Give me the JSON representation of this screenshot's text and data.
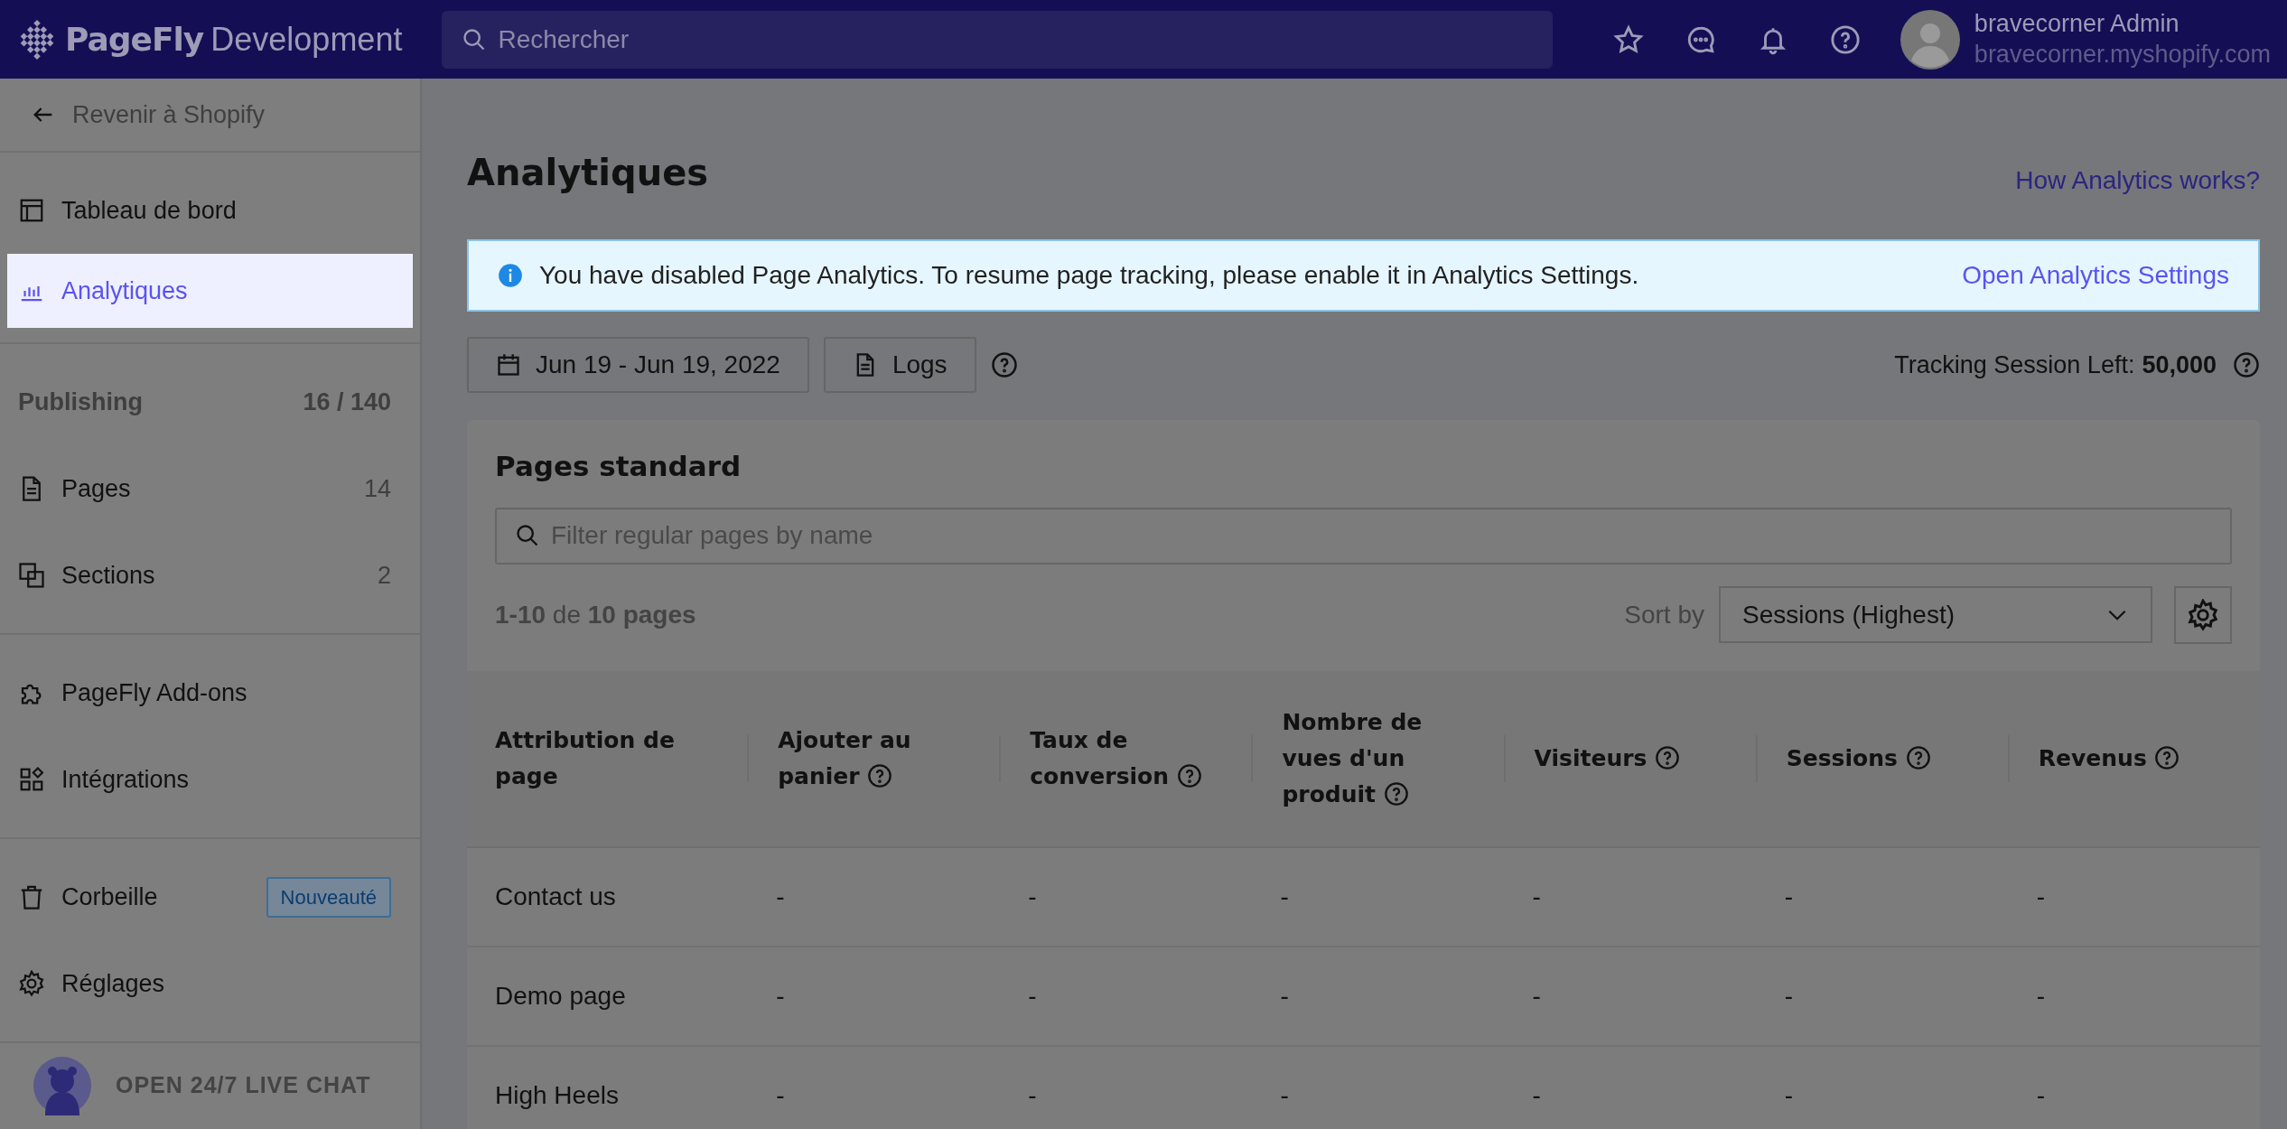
{
  "topbar": {
    "brand": "PageFly",
    "brand_suffix": "Development",
    "search": {
      "placeholder": "Rechercher"
    },
    "user": {
      "name": "bravecorner Admin",
      "shop": "bravecorner.myshopify.com"
    }
  },
  "sidebar": {
    "back": "Revenir à Shopify",
    "groups": [
      [
        {
          "kind": "link",
          "label": "Tableau de bord",
          "selected": false
        },
        {
          "kind": "link",
          "label": "Analytiques",
          "selected": true
        }
      ],
      [
        {
          "kind": "heading",
          "label": "Publishing",
          "count": "16 / 140"
        },
        {
          "kind": "link",
          "label": "Pages",
          "count": "14",
          "selected": false
        },
        {
          "kind": "link",
          "label": "Sections",
          "count": "2",
          "selected": false
        }
      ],
      [
        {
          "kind": "link",
          "label": "PageFly Add-ons",
          "selected": false
        },
        {
          "kind": "link",
          "label": "Intégrations",
          "selected": false
        }
      ],
      [
        {
          "kind": "link",
          "label": "Corbeille",
          "badge": "Nouveauté",
          "selected": false
        },
        {
          "kind": "link",
          "label": "Réglages",
          "selected": false
        }
      ]
    ],
    "chat": "OPEN 24/7 LIVE CHAT"
  },
  "page": {
    "title": "Analytiques",
    "help_link": "How Analytics works?"
  },
  "banner": {
    "text": "You have disabled Page Analytics. To resume page tracking, please enable it in Analytics Settings.",
    "link": "Open Analytics Settings"
  },
  "toolbar": {
    "date_range": "Jun 19 - Jun 19, 2022",
    "logs": "Logs",
    "tracking_label": "Tracking Session Left:",
    "tracking_value": "50,000"
  },
  "card": {
    "title": "Pages standard",
    "filter": {
      "placeholder": "Filter regular pages by name"
    },
    "count": "**1-10** de **10 pages**",
    "sort_label": "Sort by",
    "sort_value": "Sessions (Highest)",
    "table": {
      "columns": [
        {
          "label": "Attribution de page",
          "help": false
        },
        {
          "label": "Ajouter au panier",
          "help": true
        },
        {
          "label": "Taux de conversion",
          "help": true
        },
        {
          "label": "Nombre de vues d'un produit",
          "help": true
        },
        {
          "label": "Visiteurs",
          "help": true
        },
        {
          "label": "Sessions",
          "help": true
        },
        {
          "label": "Revenus",
          "help": true
        }
      ],
      "rows": [
        [
          "Contact us",
          "-",
          "-",
          "-",
          "-",
          "-",
          "-"
        ],
        [
          "Demo page",
          "-",
          "-",
          "-",
          "-",
          "-",
          "-"
        ],
        [
          "High Heels",
          "-",
          "-",
          "-",
          "-",
          "-",
          "-"
        ]
      ]
    }
  }
}
